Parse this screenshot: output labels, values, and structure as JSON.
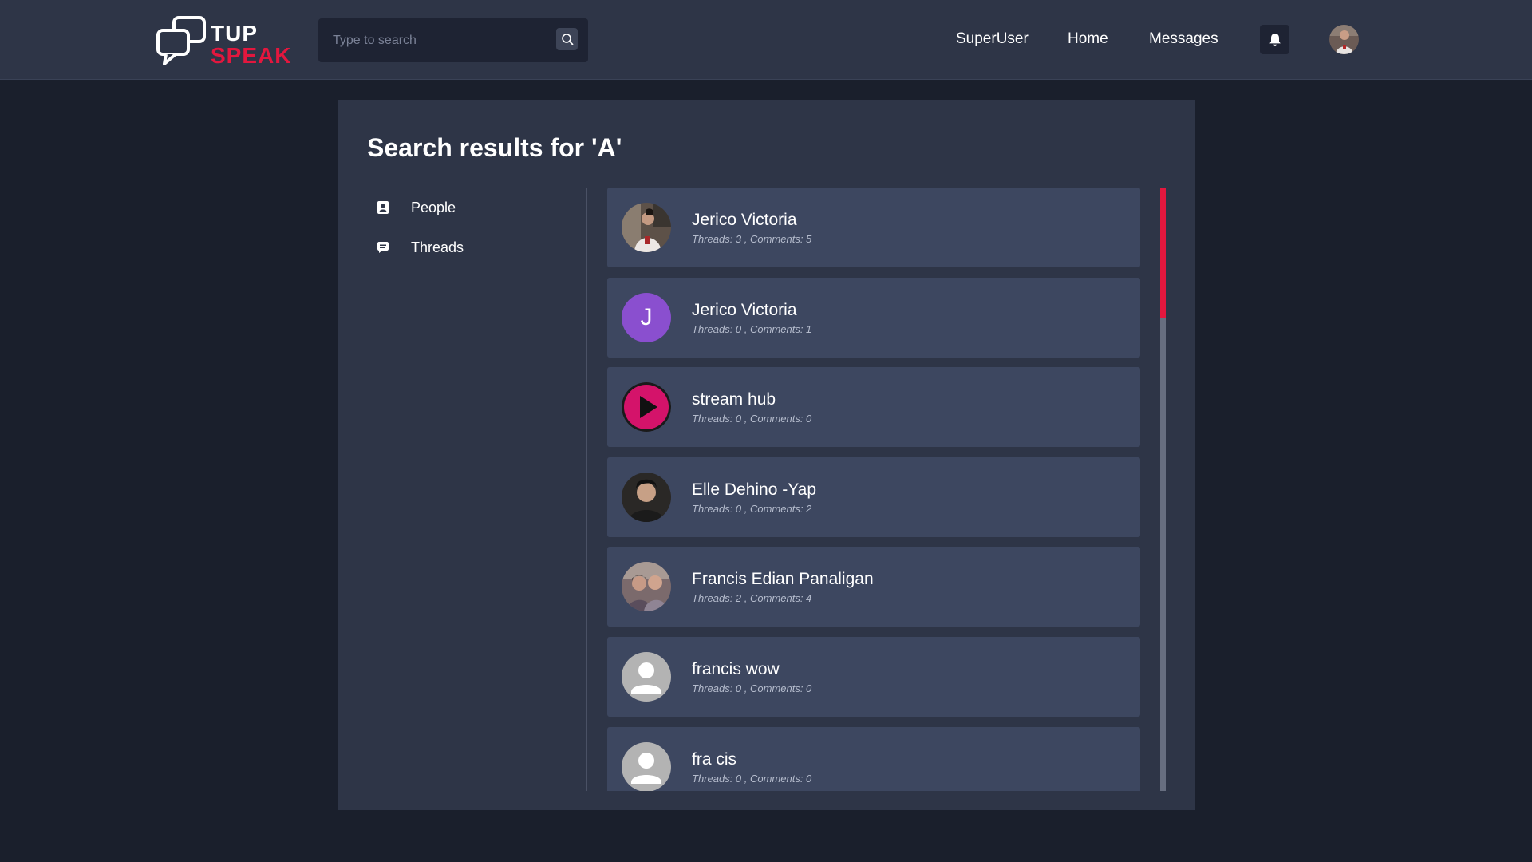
{
  "brand": {
    "line1": "TUP",
    "line2": "SPEAK",
    "accent_color": "#e3173e"
  },
  "search": {
    "placeholder": "Type to search",
    "value": "",
    "icon": "search-icon"
  },
  "nav": {
    "superuser": "SuperUser",
    "home": "Home",
    "messages": "Messages",
    "bell_icon": "bell-icon"
  },
  "page": {
    "title": "Search results for 'A'"
  },
  "sidebar": {
    "items": [
      {
        "label": "People",
        "icon": "contact-card-icon"
      },
      {
        "label": "Threads",
        "icon": "message-icon"
      }
    ]
  },
  "results": [
    {
      "name": "Jerico Victoria",
      "stats": "Threads: 3 , Comments: 5",
      "avatar": "photo"
    },
    {
      "name": "Jerico Victoria",
      "stats": "Threads: 0 , Comments: 1",
      "avatar": "letter",
      "letter": "J",
      "avatar_color": "#8a4fcf"
    },
    {
      "name": "stream hub",
      "stats": "Threads: 0 , Comments: 0",
      "avatar": "play"
    },
    {
      "name": "Elle Dehino -Yap",
      "stats": "Threads: 0 , Comments: 2",
      "avatar": "photo"
    },
    {
      "name": "Francis Edian Panaligan",
      "stats": "Threads: 2 , Comments: 4",
      "avatar": "photo"
    },
    {
      "name": "francis wow",
      "stats": "Threads: 0 , Comments: 0",
      "avatar": "default"
    },
    {
      "name": "fra cis",
      "stats": "Threads: 0 , Comments: 0",
      "avatar": "default"
    }
  ]
}
